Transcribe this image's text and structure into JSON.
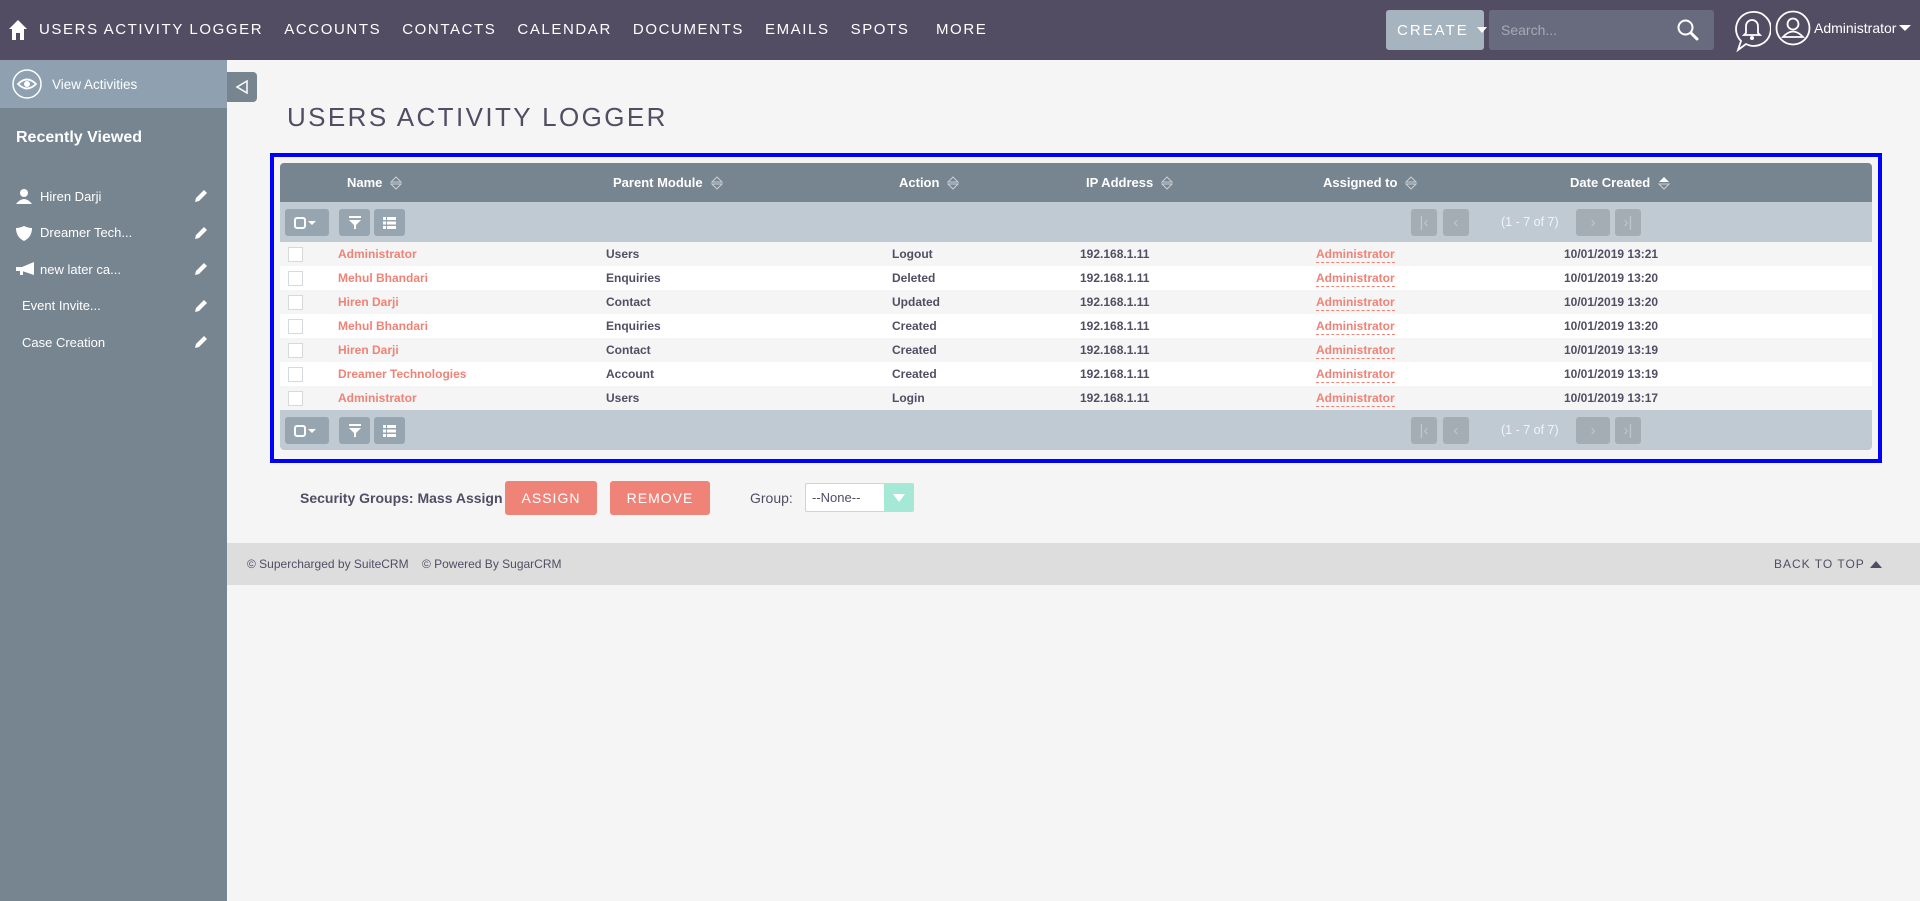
{
  "nav": {
    "home_icon": "home-icon",
    "items": [
      "USERS ACTIVITY LOGGER",
      "ACCOUNTS",
      "CONTACTS",
      "CALENDAR",
      "DOCUMENTS",
      "EMAILS",
      "SPOTS"
    ],
    "more_label": "MORE",
    "create_label": "CREATE",
    "search_placeholder": "Search...",
    "user_name": "Administrator"
  },
  "sidebar": {
    "action_label": "View Activities",
    "recently_viewed_title": "Recently Viewed",
    "recent_items": [
      {
        "label": "Hiren Darji",
        "icon": "person-icon"
      },
      {
        "label": "Dreamer Tech...",
        "icon": "shield-icon"
      },
      {
        "label": "new later ca...",
        "icon": "megaphone-icon"
      },
      {
        "label": "Event Invite...",
        "icon": ""
      },
      {
        "label": "Case Creation",
        "icon": ""
      }
    ]
  },
  "page": {
    "title": "USERS ACTIVITY LOGGER"
  },
  "list": {
    "columns": [
      "Name",
      "Parent Module",
      "Action",
      "IP Address",
      "Assigned to",
      "Date Created"
    ],
    "sorted_column": "Date Created",
    "pagination_text": "(1 - 7 of 7)",
    "rows": [
      {
        "name": "Administrator",
        "module": "Users",
        "action": "Logout",
        "ip": "192.168.1.11",
        "assigned": "Administrator",
        "date": "10/01/2019 13:21"
      },
      {
        "name": "Mehul Bhandari",
        "module": "Enquiries",
        "action": "Deleted",
        "ip": "192.168.1.11",
        "assigned": "Administrator",
        "date": "10/01/2019 13:20"
      },
      {
        "name": "Hiren Darji",
        "module": "Contact",
        "action": "Updated",
        "ip": "192.168.1.11",
        "assigned": "Administrator",
        "date": "10/01/2019 13:20"
      },
      {
        "name": "Mehul Bhandari",
        "module": "Enquiries",
        "action": "Created",
        "ip": "192.168.1.11",
        "assigned": "Administrator",
        "date": "10/01/2019 13:20"
      },
      {
        "name": "Hiren Darji",
        "module": "Contact",
        "action": "Created",
        "ip": "192.168.1.11",
        "assigned": "Administrator",
        "date": "10/01/2019 13:19"
      },
      {
        "name": "Dreamer Technologies",
        "module": "Account",
        "action": "Created",
        "ip": "192.168.1.11",
        "assigned": "Administrator",
        "date": "10/01/2019 13:19"
      },
      {
        "name": "Administrator",
        "module": "Users",
        "action": "Login",
        "ip": "192.168.1.11",
        "assigned": "Administrator",
        "date": "10/01/2019 13:17"
      }
    ]
  },
  "mass_assign": {
    "label": "Security Groups: Mass Assign",
    "assign_label": "ASSIGN",
    "remove_label": "REMOVE",
    "group_label": "Group:",
    "group_value": "--None--"
  },
  "footer": {
    "supercharged": "© Supercharged by SuiteCRM",
    "powered": "© Powered By SugarCRM",
    "back_to_top": "BACK TO TOP"
  },
  "colors": {
    "nav_bg": "#534d64",
    "sidebar_bg": "#778591",
    "link": "#f08377",
    "highlight_border": "#0000ff",
    "select_accent": "#a5e8d6"
  }
}
